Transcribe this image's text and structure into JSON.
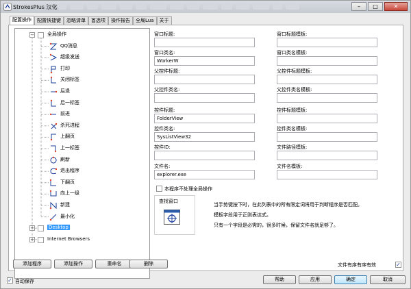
{
  "window": {
    "title": "StrokesPlus 汉化",
    "blurred_tab_widths": [
      12,
      20,
      16,
      22,
      18,
      16,
      24,
      20,
      18,
      22,
      16,
      20,
      24,
      14,
      20
    ]
  },
  "tabs": [
    {
      "label": "配置操作",
      "active": true
    },
    {
      "label": "配置快捷键",
      "active": false
    },
    {
      "label": "忽略清单",
      "active": false
    },
    {
      "label": "首选项",
      "active": false
    },
    {
      "label": "操作报告",
      "active": false
    },
    {
      "label": "全局Lua",
      "active": false
    },
    {
      "label": "关于",
      "active": false
    }
  ],
  "tree": {
    "root_label": "全局操作",
    "actions": [
      {
        "label": "QQ消息",
        "gesture": "z-shape"
      },
      {
        "label": "超级发送",
        "gesture": "arrow-right"
      },
      {
        "label": "打印",
        "gesture": "p-shape"
      },
      {
        "label": "关闭标签",
        "gesture": "l-shape"
      },
      {
        "label": "后退",
        "gesture": "line-left"
      },
      {
        "label": "后一标签",
        "gesture": "down-right"
      },
      {
        "label": "前进",
        "gesture": "line-right"
      },
      {
        "label": "杀死进程",
        "gesture": "alpha"
      },
      {
        "label": "上翻页",
        "gesture": "up-right"
      },
      {
        "label": "上一标签",
        "gesture": "up-left"
      },
      {
        "label": "刷新",
        "gesture": "circle"
      },
      {
        "label": "退出程序",
        "gesture": "c-shape"
      },
      {
        "label": "下翻页",
        "gesture": "down-right-2"
      },
      {
        "label": "向上一级",
        "gesture": "u-shape"
      },
      {
        "label": "新建",
        "gesture": "n-shape"
      },
      {
        "label": "最小化",
        "gesture": "diagonal"
      }
    ],
    "app_nodes": [
      {
        "label": "Desktop",
        "selected": true
      },
      {
        "label": "Internet Browsers",
        "selected": false
      }
    ]
  },
  "fields": {
    "window_title": {
      "label": "窗口标题:",
      "value": ""
    },
    "window_title_pattern": {
      "label": "窗口标题模板:",
      "value": ""
    },
    "window_class": {
      "label": "窗口类名:",
      "value": "WorkerW"
    },
    "window_class_pattern": {
      "label": "窗口类名模板:",
      "value": ""
    },
    "parent_title": {
      "label": "父控件标题:",
      "value": ""
    },
    "parent_title_pattern": {
      "label": "父控件标题模板:",
      "value": ""
    },
    "parent_class": {
      "label": "父控件类名:",
      "value": ""
    },
    "parent_class_pattern": {
      "label": "父控件类名模板:",
      "value": ""
    },
    "control_title": {
      "label": "控件标题:",
      "value": "FolderView"
    },
    "control_title_pattern": {
      "label": "控件标题模板:",
      "value": ""
    },
    "control_class": {
      "label": "控件类名:",
      "value": "SysListView32"
    },
    "control_class_pattern": {
      "label": "控件类名模板:",
      "value": ""
    },
    "control_id": {
      "label": "控件ID:",
      "value": ""
    },
    "file_path_pattern": {
      "label": "文件路径模板:",
      "value": ""
    },
    "file_name": {
      "label": "文件名:",
      "value": "explorer.exe"
    },
    "file_name_pattern": {
      "label": "文件名模板:",
      "value": ""
    }
  },
  "no_global_actions": {
    "label": "本程序不处理全局操作",
    "checked": false
  },
  "finder": {
    "title": "查找窗口"
  },
  "info_lines": [
    "当手势键按下时，在此列表中的所有限定词将用于判断程序是否匹配。",
    "模板字段用于正则表达式。",
    "只有一个字段是必需的，很多时候，保留文件名就足够了。"
  ],
  "file_order": {
    "label": "文件有序有序有效",
    "checked": true
  },
  "tree_buttons": {
    "add_app": "添加程序",
    "add_action": "添加操作",
    "rename": "重命名",
    "delete": "删除"
  },
  "autosave": {
    "label": "自动保存",
    "checked": true
  },
  "dialog_buttons": {
    "help": "帮助",
    "apply": "应用",
    "ok": "确定",
    "cancel": "取消"
  },
  "colors": {
    "selection": "#3399ff",
    "gesture_stroke": "#1a3c9a",
    "gesture_start": "#e0402a"
  }
}
